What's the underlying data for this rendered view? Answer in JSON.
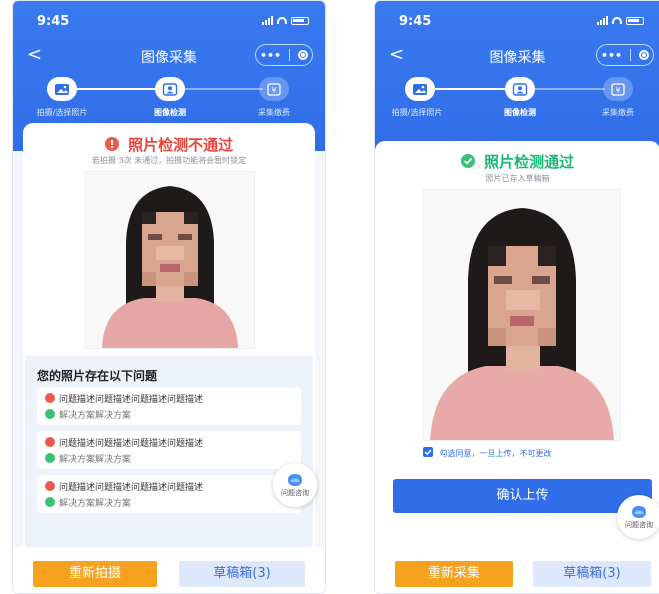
{
  "status": {
    "time": "9:45"
  },
  "nav": {
    "title": "图像采集",
    "more": "•••"
  },
  "steps": [
    "拍摄/选择照片",
    "图像检测",
    "采集缴费"
  ],
  "left": {
    "result_title": "照片检测不通过",
    "result_subtitle": "若拍摄 3次 未通过，拍摄功能将会暂时锁定",
    "issues_heading": "您的照片存在以下问题",
    "issues": [
      {
        "problem": "问题描述问题描述问题描述问题描述",
        "solution": "解决方案解决方案"
      },
      {
        "problem": "问题描述问题描述问题描述问题描述",
        "solution": "解决方案解决方案"
      },
      {
        "problem": "问题描述问题描述问题描述问题描述",
        "solution": "解决方案解决方案"
      }
    ],
    "consult_label": "问题咨询",
    "retake_button": "重新拍摄",
    "drafts_button": "草稿箱(3)"
  },
  "right": {
    "result_title": "照片检测通过",
    "result_subtitle": "照片已存入草稿箱",
    "agree_text": "勾选同意，一旦上传，不可更改",
    "agree_checked": true,
    "confirm_button": "确认上传",
    "consult_label": "问题咨询",
    "recollect_button": "重新采集",
    "drafts_button": "草稿箱(3)"
  },
  "colors": {
    "header_blue": "#2f6ee8",
    "fail_red": "#e8453c",
    "pass_green": "#1ab877",
    "orange": "#f7a21f",
    "light_blue": "#dde9fb"
  }
}
